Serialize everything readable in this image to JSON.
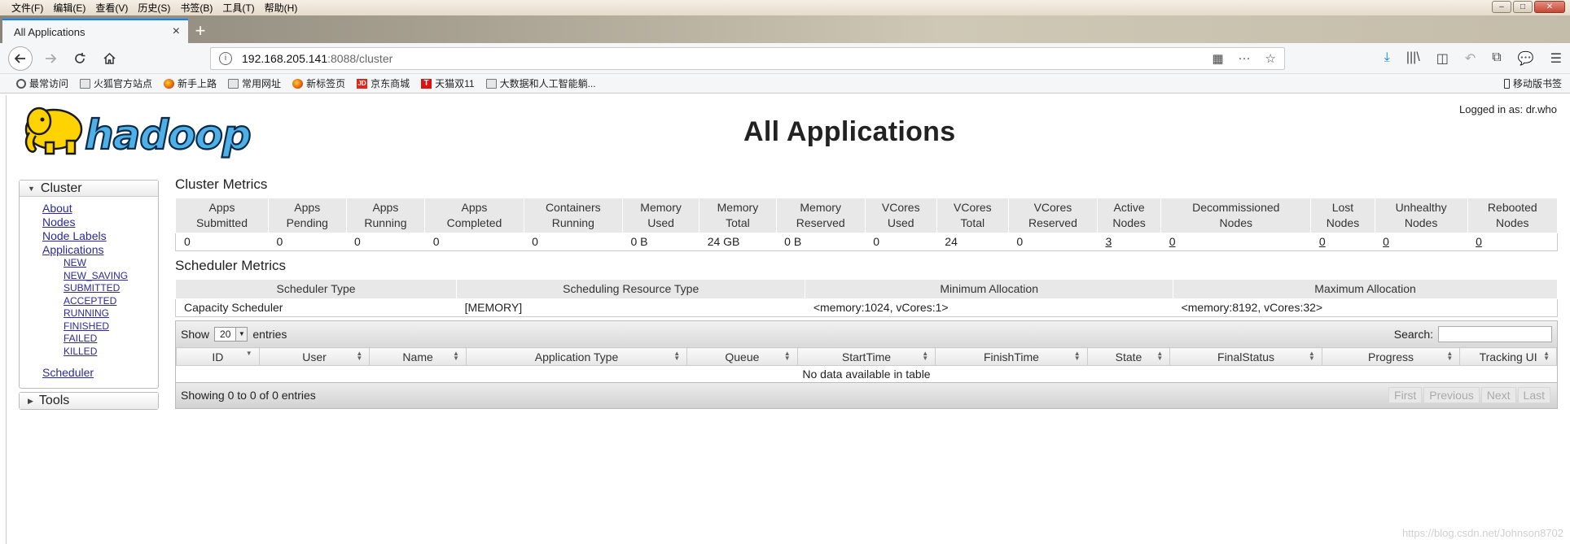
{
  "menubar": {
    "items": [
      "文件(F)",
      "编辑(E)",
      "查看(V)",
      "历史(S)",
      "书签(B)",
      "工具(T)",
      "帮助(H)"
    ]
  },
  "window": {
    "minimize": "–",
    "maximize": "□",
    "close": "✕"
  },
  "tab": {
    "title": "All Applications",
    "close": "×",
    "new": "+"
  },
  "url": {
    "host": "192.168.205.141",
    "path": ":8088/cluster"
  },
  "bookmarks": [
    {
      "label": "最常访问",
      "icon": "gear-icon"
    },
    {
      "label": "火狐官方站点",
      "icon": "folder-icon"
    },
    {
      "label": "新手上路",
      "icon": "firefox-icon"
    },
    {
      "label": "常用网址",
      "icon": "folder-icon"
    },
    {
      "label": "新标签页",
      "icon": "firefox-icon"
    },
    {
      "label": "京东商城",
      "icon": "jd-icon"
    },
    {
      "label": "天猫双11",
      "icon": "tmall-icon"
    },
    {
      "label": "大数据和人工智能躺...",
      "icon": "folder-icon"
    }
  ],
  "mobile_bookmarks": "移动版书签",
  "page": {
    "logged_in": "Logged in as: dr.who",
    "title": "All Applications",
    "logo_text": "hadoop"
  },
  "sidebar": {
    "cluster": "Cluster",
    "links": [
      "About",
      "Nodes",
      "Node Labels",
      "Applications"
    ],
    "sublinks": [
      "NEW",
      "NEW_SAVING",
      "SUBMITTED",
      "ACCEPTED",
      "RUNNING",
      "FINISHED",
      "FAILED",
      "KILLED"
    ],
    "scheduler": "Scheduler",
    "tools": "Tools"
  },
  "cluster_metrics": {
    "title": "Cluster Metrics",
    "headers": [
      [
        "Apps",
        "Submitted"
      ],
      [
        "Apps",
        "Pending"
      ],
      [
        "Apps",
        "Running"
      ],
      [
        "Apps",
        "Completed"
      ],
      [
        "Containers",
        "Running"
      ],
      [
        "Memory",
        "Used"
      ],
      [
        "Memory",
        "Total"
      ],
      [
        "Memory",
        "Reserved"
      ],
      [
        "VCores",
        "Used"
      ],
      [
        "VCores",
        "Total"
      ],
      [
        "VCores",
        "Reserved"
      ],
      [
        "Active",
        "Nodes"
      ],
      [
        "Decommissioned",
        "Nodes"
      ],
      [
        "Lost",
        "Nodes"
      ],
      [
        "Unhealthy",
        "Nodes"
      ],
      [
        "Rebooted",
        "Nodes"
      ]
    ],
    "values": [
      "0",
      "0",
      "0",
      "0",
      "0",
      "0 B",
      "24 GB",
      "0 B",
      "0",
      "24",
      "0",
      "3",
      "0",
      "0",
      "0",
      "0"
    ]
  },
  "scheduler_metrics": {
    "title": "Scheduler Metrics",
    "headers": [
      "Scheduler Type",
      "Scheduling Resource Type",
      "Minimum Allocation",
      "Maximum Allocation"
    ],
    "values": [
      "Capacity Scheduler",
      "[MEMORY]",
      "<memory:1024, vCores:1>",
      "<memory:8192, vCores:32>"
    ]
  },
  "apps": {
    "show_label": "Show",
    "page_length": "20",
    "entries_label": "entries",
    "search_label": "Search:",
    "columns": [
      "ID",
      "User",
      "Name",
      "Application Type",
      "Queue",
      "StartTime",
      "FinishTime",
      "State",
      "FinalStatus",
      "Progress",
      "Tracking UI"
    ],
    "empty": "No data available in table",
    "info": "Showing 0 to 0 of 0 entries",
    "pager": [
      "First",
      "Previous",
      "Next",
      "Last"
    ]
  },
  "watermark": "https://blog.csdn.net/Johnson8702"
}
